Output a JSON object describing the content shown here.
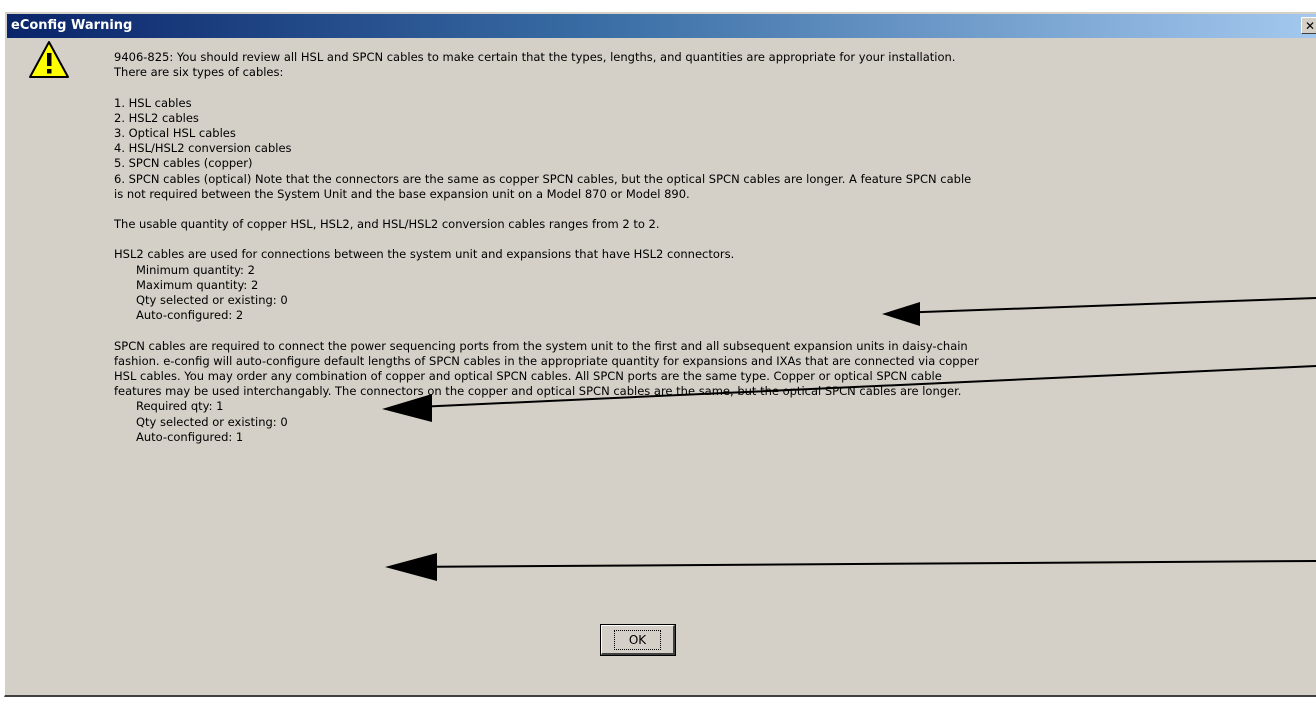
{
  "window": {
    "title": "eConfig Warning",
    "close_label": "✕"
  },
  "icon": {
    "name": "warning-icon",
    "glyph": "!",
    "fill": "#ffff00"
  },
  "message": {
    "intro_1": "9406-825: You should review all HSL and SPCN cables to make certain that the types, lengths, and quantities are appropriate for your installation.",
    "intro_2": "There are six types of cables:",
    "cable_types": [
      "1. HSL cables",
      "2. HSL2 cables",
      "3. Optical HSL cables",
      "4. HSL/HSL2 conversion cables",
      "5. SPCN cables (copper)",
      "6. SPCN cables (optical)  Note that the connectors are the same as copper SPCN cables, but the optical SPCN cables are longer.  A feature SPCN cable"
    ],
    "cable_types_cont": "is not required between the System Unit and the base expansion unit on a Model 870 or Model 890.",
    "usable_qty": "The usable quantity of copper HSL, HSL2, and HSL/HSL2 conversion cables ranges from 2 to 2.",
    "hsl2_intro": "HSL2 cables are used for connections between the system unit and expansions that have HSL2 connectors.",
    "hsl2_details": [
      "Minimum quantity:  2",
      "Maximum quantity:  2",
      "Qty selected or existing:  0",
      "Auto-configured:  2"
    ],
    "spcn_paragraph": [
      "SPCN cables are required to connect the power sequencing ports from the system unit to the first and all subsequent expansion units in daisy-chain",
      "fashion.  e-config will auto-configure default lengths of SPCN cables in the appropriate quantity for expansions and IXAs that are connected via copper",
      "HSL cables.  You may order any combination of copper and optical SPCN cables.  All SPCN ports are the same type.  Copper or optical SPCN cable",
      "features may be used interchangably.  The connectors on the copper and optical SPCN cables are the same, but the optical SPCN cables are longer."
    ],
    "spcn_details": [
      "Required qty:  1",
      "Qty selected or existing:  0",
      "Auto-configured:  1"
    ]
  },
  "buttons": {
    "ok_label": "OK"
  }
}
